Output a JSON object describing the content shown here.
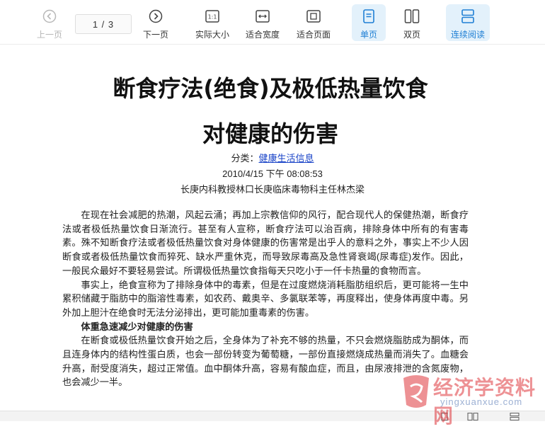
{
  "toolbar": {
    "prev_label": "上一页",
    "next_label": "下一页",
    "page_indicator": "1 / 3",
    "actual_size_label": "实际大小",
    "fit_width_label": "适合宽度",
    "fit_page_label": "适合页面",
    "single_page_label": "单页",
    "double_page_label": "双页",
    "continuous_label": "连续阅读"
  },
  "document": {
    "title_line1": "断食疗法(绝食)及极低热量饮食",
    "title_line2": "对健康的伤害",
    "category_prefix": "分类：",
    "category_link": "健康生活信息",
    "datetime": "2010/4/15 下午 08:08:53",
    "author": "长庚内科教授林口长庚临床毒物科主任林杰梁",
    "para1": "在现在社会减肥的热潮，风起云涌；再加上宗教信仰的风行，配合现代人的保健热潮，断食疗法或者极低热量饮食日渐流行。甚至有人宣称，断食疗法可以治百病，排除身体中所有的有害毒素。殊不知断食疗法或者极低热量饮食对身体健康的伤害常是出乎人的意料之外，事实上不少人因断食或者极低热量饮食而猝死、缺水严重休克，而导致尿毒高及急性肾衰竭(尿毒症)发作。因此，一般民众最好不要轻易尝试。所谓极低热量饮食指每天只吃小于一仟卡热量的食物而言。",
    "para2": "事实上，绝食宣称为了排除身体中的毒素，但是在过度燃烧消耗脂肪组织后，更可能将一生中累积储藏于脂肪中的脂溶性毒素，如农药、戴奥辛、多氯联苯等，再度释出，使身体再度中毒。另外加上胆汁在绝食时无法分泌排出，更可能加重毒素的伤害。",
    "heading1": "体重急速减少对健康的伤害",
    "para3": "在断食或极低热量饮食开始之后，全身体为了补充不够的热量，不只会燃烧脂肪成为酮体，而且连身体内的结构性蛋白质，也会一部份转变为葡萄糖，一部份直接燃烧成热量而消失了。血糖会升高，耐受度消失，超过正常值。血中酮体升高，容易有酸血症，而且，由尿液排泄的含氮废物，也会减少一半。"
  },
  "watermark": {
    "text": "经济学资料网",
    "url": "yingxuanxue.com"
  },
  "colors": {
    "accent": "#1f7fd4",
    "active_bg": "#e3f1fb",
    "link": "#1a44c8",
    "watermark_red": "#e0383e"
  },
  "icons": [
    "chevron-left-circle-icon",
    "chevron-right-circle-icon",
    "actual-size-icon",
    "fit-width-icon",
    "fit-page-icon",
    "single-page-icon",
    "double-page-icon",
    "continuous-icon"
  ]
}
